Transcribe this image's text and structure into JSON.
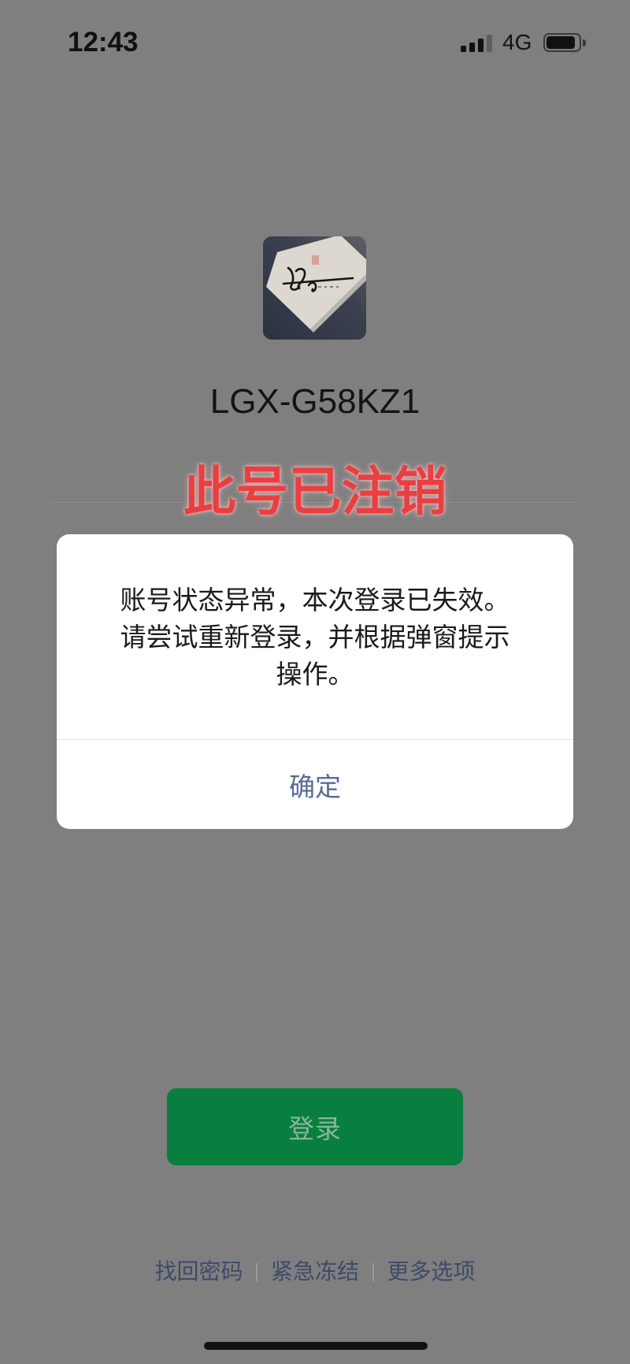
{
  "status_bar": {
    "time": "12:43",
    "network": "4G",
    "signal_bars": 3,
    "battery_level": 0.9
  },
  "profile": {
    "username": "LGX-G58KZ1"
  },
  "stamp": {
    "text": "此号已注销"
  },
  "dialog": {
    "message_lines": [
      "账号状态异常，本次登录已失效。",
      "请尝试重新登录，并根据弹窗提示",
      "操作。"
    ],
    "confirm_label": "确定"
  },
  "login_button": {
    "label": "登录"
  },
  "footer": {
    "links": [
      {
        "label": "找回密码"
      },
      {
        "label": "紧急冻结"
      },
      {
        "label": "更多选项"
      }
    ]
  },
  "colors": {
    "background": "#7f7f7f",
    "login_button": "#087f3e",
    "dialog_link": "#576b95",
    "footer_link": "#3e4a69",
    "stamp_red": "#ea3f41"
  }
}
